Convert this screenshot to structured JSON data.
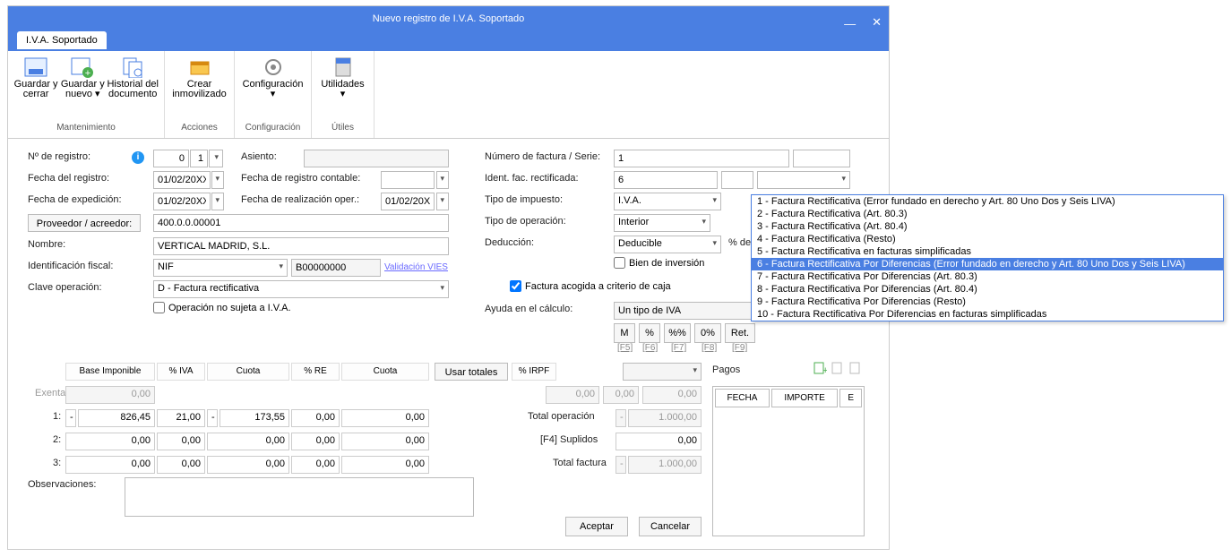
{
  "title": "Nuevo registro de I.V.A. Soportado",
  "tab": "I.V.A. Soportado",
  "ribbon": {
    "groups": [
      {
        "label": "Mantenimiento",
        "items": [
          {
            "name": "guardar-cerrar",
            "label": "Guardar y cerrar"
          },
          {
            "name": "guardar-nuevo",
            "label": "Guardar y nuevo ▾"
          },
          {
            "name": "historial",
            "label": "Historial del documento"
          }
        ]
      },
      {
        "label": "Acciones",
        "items": [
          {
            "name": "crear-inmov",
            "label": "Crear inmovilizado"
          }
        ]
      },
      {
        "label": "Configuración",
        "items": [
          {
            "name": "config",
            "label": "Configuración ▾"
          }
        ]
      },
      {
        "label": "Útiles",
        "items": [
          {
            "name": "util",
            "label": "Utilidades ▾"
          }
        ]
      }
    ]
  },
  "labels": {
    "nreg": "Nº de registro:",
    "freg": "Fecha del registro:",
    "fexp": "Fecha de expedición:",
    "prov": "Proveedor / acreedor:",
    "nombre": "Nombre:",
    "idfiscal": "Identificación fiscal:",
    "claveop": "Clave operación:",
    "opnosujeta": "Operación no sujeta a I.V.A.",
    "asiento": "Asiento:",
    "fregcont": "Fecha de registro contable:",
    "freal": "Fecha de realización oper.:",
    "nfact": "Número de factura / Serie:",
    "idrect": "Ident. fac. rectificada:",
    "timpuesto": "Tipo de impuesto:",
    "toper": "Tipo de operación:",
    "deducc": "Deducción:",
    "pctdedu": "% dedu",
    "bieninv": "Bien de inversión",
    "factcaja": "Factura acogida a criterio de caja",
    "ayuda": "Ayuda en el cálculo:",
    "baseimp": "Base Imponible",
    "pctiva": "% IVA",
    "cuota": "Cuota",
    "pctre": "% RE",
    "cuota2": "Cuota",
    "usartot": "Usar totales",
    "pctirpf": "% IRPF",
    "pagos": "Pagos",
    "exenta": "Exenta:",
    "r1": "1:",
    "r2": "2:",
    "r3": "3:",
    "obs": "Observaciones:",
    "totop": "Total operación",
    "suplidos": "[F4] Suplidos",
    "totfact": "Total factura",
    "aceptar": "Aceptar",
    "cancelar": "Cancelar",
    "fecha": "FECHA",
    "importe": "IMPORTE",
    "e": "E",
    "vvies": "Validación VIES"
  },
  "values": {
    "nreg1": "0",
    "nreg2": "1",
    "freg": "01/02/20XX",
    "fexp": "01/02/20XX",
    "prov": "400.0.0.00001",
    "nombre": "VERTICAL MADRID, S.L.",
    "nif": "NIF",
    "nifnum": "B00000000",
    "claveop": "D - Factura rectificativa",
    "freal": "01/02/20XX",
    "nfact": "1",
    "idrect": "6",
    "timpuesto": "I.V.A.",
    "toper": "Interior",
    "deducc": "Deducible",
    "ayuda": "Un tipo de IVA",
    "btnM": "M",
    "btnPct": "%",
    "btnPctPct": "%%",
    "btn0": "0%",
    "btnRet": "Ret.",
    "f5": "[F5]",
    "f6": "[F6]",
    "f7": "[F7]",
    "f8": "[F8]",
    "f9": "[F9]",
    "exenta": "0,00",
    "r1base": "826,45",
    "r1iva": "21,00",
    "r1cuota": "173,55",
    "r1re": "0,00",
    "r1cuota2": "0,00",
    "r2base": "0,00",
    "r2iva": "0,00",
    "r2cuota": "0,00",
    "r2re": "0,00",
    "r2cuota2": "0,00",
    "r3base": "0,00",
    "r3iva": "0,00",
    "r3cuota": "0,00",
    "r3re": "0,00",
    "r3cuota2": "0,00",
    "irpfbase": "0,00",
    "irpfpct": "0,00",
    "irpfcuota": "0,00",
    "totop": "1.000,00",
    "suplidos": "0,00",
    "totfact": "1.000,00",
    "neg": "-"
  },
  "dropdown": [
    "1 - Factura Rectificativa (Error fundado en derecho y Art. 80 Uno Dos y Seis LIVA)",
    "2 - Factura Rectificativa (Art. 80.3)",
    "3 - Factura Rectificativa (Art. 80.4)",
    "4 - Factura Rectificativa (Resto)",
    "5 - Factura Rectificativa en facturas simplificadas",
    "6 - Factura Rectificativa Por Diferencias (Error fundado en derecho y Art. 80 Uno Dos y Seis LIVA)",
    "7 - Factura Rectificativa Por Diferencias (Art. 80.3)",
    "8 - Factura Rectificativa Por Diferencias (Art. 80.4)",
    "9 - Factura Rectificativa Por Diferencias (Resto)",
    "10 - Factura Rectificativa Por Diferencias en facturas simplificadas"
  ]
}
